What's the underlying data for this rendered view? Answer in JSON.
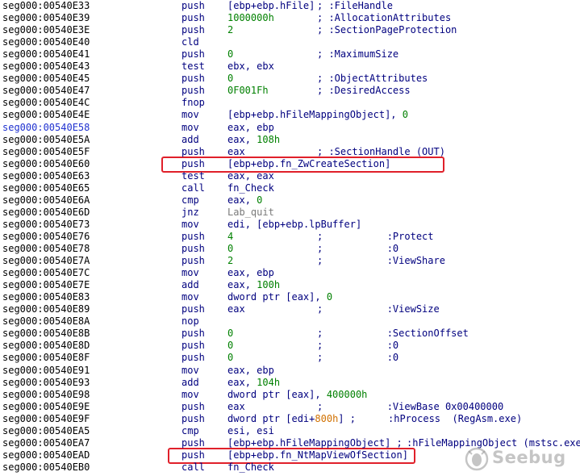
{
  "listing": {
    "rows": [
      {
        "addr": "seg000:00540E33",
        "mn": "push",
        "op": "[ebp+ebp.hFile]",
        "cm": "; :FileHandle"
      },
      {
        "addr": "seg000:00540E39",
        "mn": "push",
        "op": "1000000h",
        "cm": "; :AllocationAttributes"
      },
      {
        "addr": "seg000:00540E3E",
        "mn": "push",
        "op": "2",
        "cm": "; :SectionPageProtection"
      },
      {
        "addr": "seg000:00540E40",
        "mn": "cld",
        "op": "",
        "cm": ""
      },
      {
        "addr": "seg000:00540E41",
        "mn": "push",
        "op": "0",
        "cm": "; :MaximumSize"
      },
      {
        "addr": "seg000:00540E43",
        "mn": "test",
        "op": "ebx, ebx",
        "cm": ""
      },
      {
        "addr": "seg000:00540E45",
        "mn": "push",
        "op": "0",
        "cm": "; :ObjectAttributes"
      },
      {
        "addr": "seg000:00540E47",
        "mn": "push",
        "op": "0F001Fh",
        "cm": "; :DesiredAccess"
      },
      {
        "addr": "seg000:00540E4C",
        "mn": "fnop",
        "op": "",
        "cm": ""
      },
      {
        "addr": "seg000:00540E4E",
        "mn": "mov",
        "op": "[ebp+ebp.hFileMappingObject], 0",
        "cm": ""
      },
      {
        "addr": "seg000:00540E58",
        "mn": "mov",
        "op": "eax, ebp",
        "cm": ""
      },
      {
        "addr": "seg000:00540E5A",
        "mn": "add",
        "op": "eax, 108h",
        "cm": ""
      },
      {
        "addr": "seg000:00540E5F",
        "mn": "push",
        "op": "eax",
        "cm": "; :SectionHandle (OUT)"
      },
      {
        "addr": "seg000:00540E60",
        "mn": "push",
        "op": "[ebp+ebp.fn_ZwCreateSection]",
        "cm": ""
      },
      {
        "addr": "seg000:00540E63",
        "mn": "test",
        "op": "eax, eax",
        "cm": ""
      },
      {
        "addr": "seg000:00540E65",
        "mn": "call",
        "op": "fn_Check",
        "cm": ""
      },
      {
        "addr": "seg000:00540E6A",
        "mn": "cmp",
        "op": "eax, 0",
        "cm": ""
      },
      {
        "addr": "seg000:00540E6D",
        "mn": "jnz",
        "op": "Lab_quit",
        "cm": ""
      },
      {
        "addr": "seg000:00540E73",
        "mn": "mov",
        "op": "edi, [ebp+ebp.lpBuffer]",
        "cm": ""
      },
      {
        "addr": "seg000:00540E76",
        "mn": "push",
        "op": "4",
        "cm": ";           :Protect"
      },
      {
        "addr": "seg000:00540E78",
        "mn": "push",
        "op": "0",
        "cm": ";           :0"
      },
      {
        "addr": "seg000:00540E7A",
        "mn": "push",
        "op": "2",
        "cm": ";           :ViewShare"
      },
      {
        "addr": "seg000:00540E7C",
        "mn": "mov",
        "op": "eax, ebp",
        "cm": ""
      },
      {
        "addr": "seg000:00540E7E",
        "mn": "add",
        "op": "eax, 100h",
        "cm": ""
      },
      {
        "addr": "seg000:00540E83",
        "mn": "mov",
        "op": "dword ptr [eax], 0",
        "cm": ""
      },
      {
        "addr": "seg000:00540E89",
        "mn": "push",
        "op": "eax",
        "cm": ";           :ViewSize"
      },
      {
        "addr": "seg000:00540E8A",
        "mn": "nop",
        "op": "",
        "cm": ""
      },
      {
        "addr": "seg000:00540E8B",
        "mn": "push",
        "op": "0",
        "cm": ";           :SectionOffset"
      },
      {
        "addr": "seg000:00540E8D",
        "mn": "push",
        "op": "0",
        "cm": ";           :0"
      },
      {
        "addr": "seg000:00540E8F",
        "mn": "push",
        "op": "0",
        "cm": ";           :0"
      },
      {
        "addr": "seg000:00540E91",
        "mn": "mov",
        "op": "eax, ebp",
        "cm": ""
      },
      {
        "addr": "seg000:00540E93",
        "mn": "add",
        "op": "eax, 104h",
        "cm": ""
      },
      {
        "addr": "seg000:00540E98",
        "mn": "mov",
        "op": "dword ptr [eax], 400000h",
        "cm": ""
      },
      {
        "addr": "seg000:00540E9E",
        "mn": "push",
        "op": "eax",
        "cm": ";           :ViewBase 0x00400000"
      },
      {
        "addr": "seg000:00540E9F",
        "mn": "push",
        "op": "dword ptr [edi+800h] ;",
        "cm": ":hProcess  (RegAsm.exe)"
      },
      {
        "addr": "seg000:00540EA5",
        "mn": "cmp",
        "op": "esi, esi",
        "cm": ""
      },
      {
        "addr": "seg000:00540EA7",
        "mn": "push",
        "op": "[ebp+ebp.hFileMappingObject] ;",
        "cm": ":hFileMappingObject (mstsc.exe)"
      },
      {
        "addr": "seg000:00540EAD",
        "mn": "push",
        "op": "[ebp+ebp.fn_NtMapViewOfSection]",
        "cm": ""
      },
      {
        "addr": "seg000:00540EB0",
        "mn": "call",
        "op": "fn_Check",
        "cm": ""
      }
    ]
  },
  "watermark": {
    "text": "Seebug",
    "icon": "seebug-logo-icon"
  },
  "colors": {
    "mnemonic": "#00007f",
    "number": "#008000",
    "label": "#7a7a7a",
    "highlight_border": "#e0202a",
    "address_blue": "#1f31d0"
  }
}
